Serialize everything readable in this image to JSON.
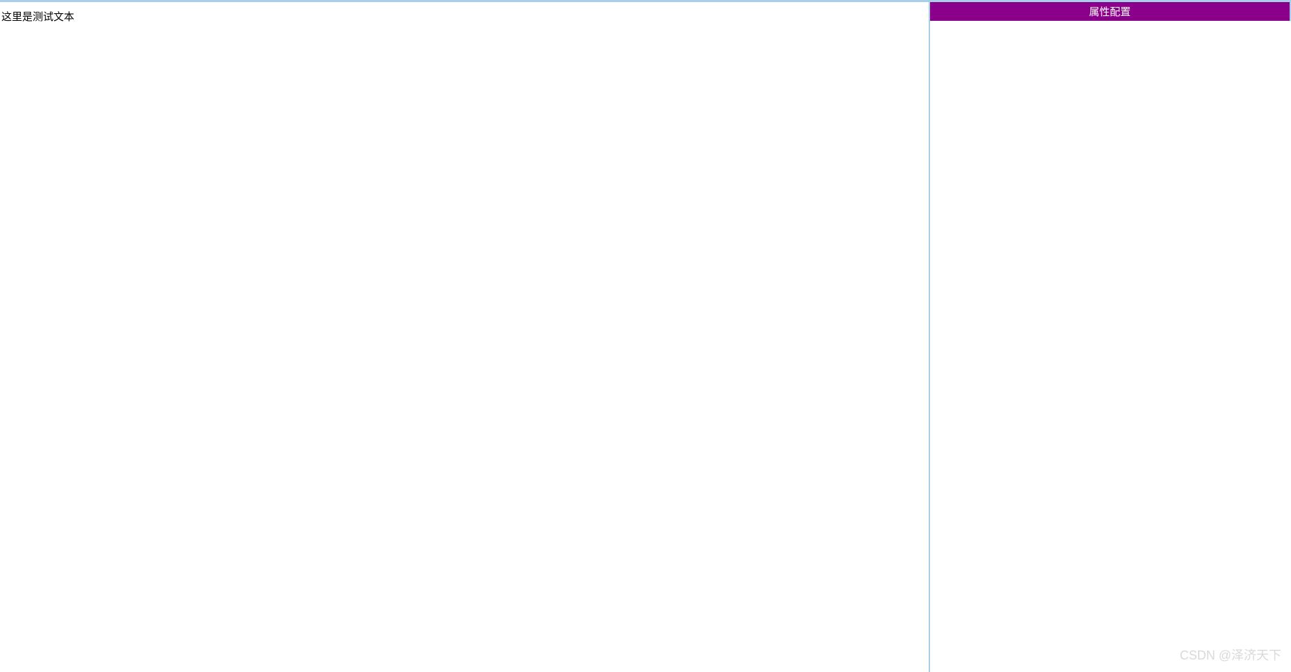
{
  "main": {
    "test_text": "这里是测试文本"
  },
  "side_panel": {
    "header_title": "属性配置"
  },
  "watermark": "CSDN @泽济天下"
}
